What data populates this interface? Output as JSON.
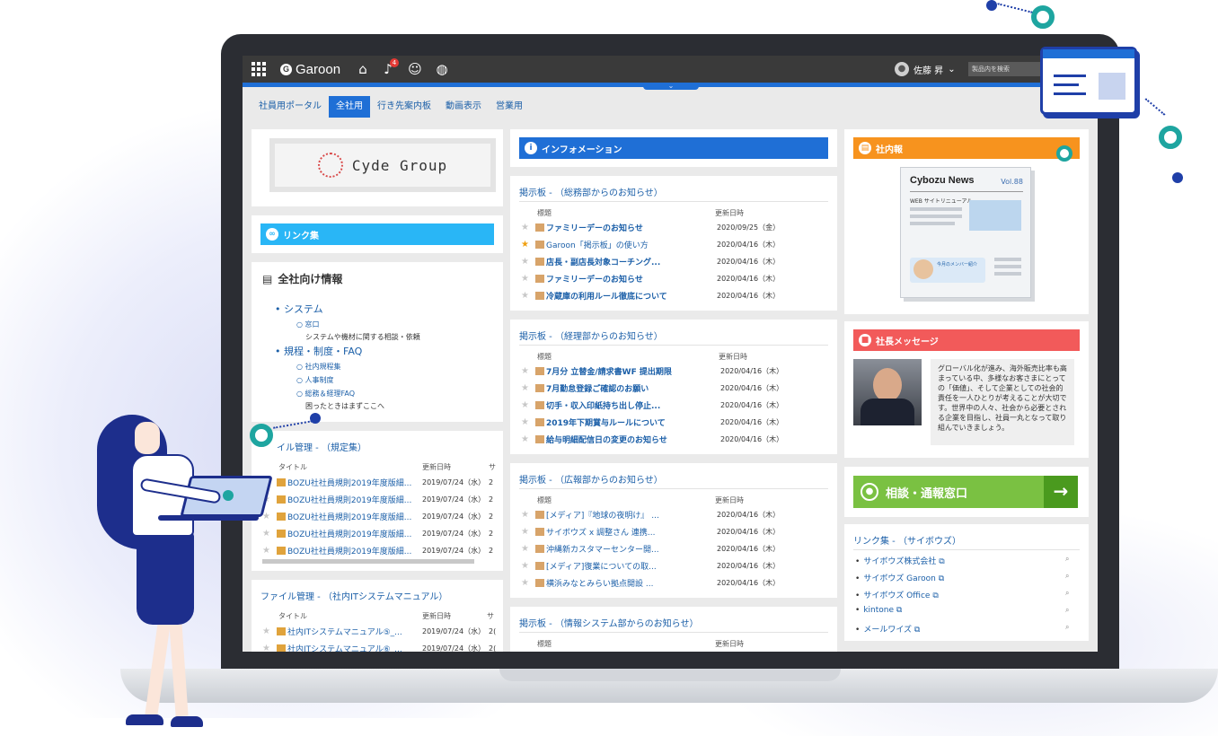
{
  "topbar": {
    "logo": "Garoon",
    "notification_count": "4",
    "user_name": "佐藤 昇",
    "search_placeholder": "製品内を検索"
  },
  "tabs": [
    "社員用ポータル",
    "全社用",
    "行き先案内板",
    "動画表示",
    "営業用"
  ],
  "active_tab": 1,
  "left": {
    "logo_text": "Cyde Group",
    "links_header": "リンク集",
    "info": {
      "title": "全社向け情報",
      "items": [
        {
          "label": "システム",
          "children": [
            {
              "label": "窓口",
              "note": "システムや機材に関する相談・依頼"
            }
          ]
        },
        {
          "label": "規程・制度・FAQ",
          "children": [
            {
              "label": "社内規程集",
              "note": ""
            },
            {
              "label": "人事制度",
              "note": ""
            },
            {
              "label": "総務＆経理FAQ",
              "note": "困ったときはまずここへ"
            }
          ]
        }
      ]
    },
    "files1": {
      "title": "イル管理 - （規定集）",
      "col_title": "タイトル",
      "col_date": "更新日時",
      "col_extra": "サ",
      "rows": [
        {
          "title": "BOZU社社員規則2019年度版細...",
          "date": "2019/07/24（水）",
          "extra": "2"
        },
        {
          "title": "BOZU社社員規則2019年度版細...",
          "date": "2019/07/24（水）",
          "extra": "2"
        },
        {
          "title": "BOZU社社員規則2019年度版細...",
          "date": "2019/07/24（水）",
          "extra": "2"
        },
        {
          "title": "BOZU社社員規則2019年度版細...",
          "date": "2019/07/24（水）",
          "extra": "2"
        },
        {
          "title": "BOZU社社員規則2019年度版細...",
          "date": "2019/07/24（水）",
          "extra": "2"
        }
      ]
    },
    "files2": {
      "title": "ファイル管理 - （社内ITシステムマニュアル）",
      "col_title": "タイトル",
      "col_date": "更新日時",
      "col_extra": "サ",
      "rows": [
        {
          "title": "社内ITシステムマニュアル⑤_...",
          "date": "2019/07/24（水）",
          "extra": "2("
        },
        {
          "title": "社内ITシステムマニュアル⑥_...",
          "date": "2019/07/24（水）",
          "extra": "2("
        }
      ]
    }
  },
  "center": {
    "info_header": "インフォメーション",
    "boards": [
      {
        "title": "掲示板 - （総務部からのお知らせ）",
        "col_title": "標題",
        "col_date": "更新日時",
        "rows": [
          {
            "title": "ファミリーデーのお知らせ",
            "date": "2020/09/25（金）",
            "starred": false,
            "bold": true
          },
          {
            "title": "Garoon「掲示板」の使い方",
            "date": "2020/04/16（木）",
            "starred": true,
            "bold": false
          },
          {
            "title": "店長・副店長対象コーチング...",
            "date": "2020/04/16（木）",
            "starred": false,
            "bold": true
          },
          {
            "title": "ファミリーデーのお知らせ",
            "date": "2020/04/16（木）",
            "starred": false,
            "bold": true
          },
          {
            "title": "冷蔵庫の利用ルール徹底について",
            "date": "2020/04/16（木）",
            "starred": false,
            "bold": true
          }
        ]
      },
      {
        "title": "掲示板 - （経理部からのお知らせ）",
        "col_title": "標題",
        "col_date": "更新日時",
        "rows": [
          {
            "title": "7月分 立替金/請求書WF 提出期限",
            "date": "2020/04/16（木）",
            "starred": false,
            "bold": true
          },
          {
            "title": "7月勤怠登録ご確認のお願い",
            "date": "2020/04/16（木）",
            "starred": false,
            "bold": true
          },
          {
            "title": "切手・収入印紙持ち出し停止...",
            "date": "2020/04/16（木）",
            "starred": false,
            "bold": true
          },
          {
            "title": "2019年下期賞与ルールについて",
            "date": "2020/04/16（木）",
            "starred": false,
            "bold": true
          },
          {
            "title": "給与明細配信日の変更のお知らせ",
            "date": "2020/04/16（木）",
            "starred": false,
            "bold": true
          }
        ]
      },
      {
        "title": "掲示板 - （広報部からのお知らせ）",
        "col_title": "標題",
        "col_date": "更新日時",
        "rows": [
          {
            "title": "[メディア]『地球の夜明け』 ...",
            "date": "2020/04/16（木）",
            "starred": false,
            "bold": false
          },
          {
            "title": "サイボウズ x 調整さん 連携...",
            "date": "2020/04/16（木）",
            "starred": false,
            "bold": false
          },
          {
            "title": "沖縄新カスタマーセンター開...",
            "date": "2020/04/16（木）",
            "starred": false,
            "bold": false
          },
          {
            "title": "[メディア]復業についての取...",
            "date": "2020/04/16（木）",
            "starred": false,
            "bold": false
          },
          {
            "title": "横浜みなとみらい拠点開設 ...",
            "date": "2020/04/16（木）",
            "starred": false,
            "bold": false
          }
        ]
      },
      {
        "title": "掲示板 - （情報システム部からのお知らせ）",
        "col_title": "標題",
        "col_date": "更新日時",
        "rows": []
      }
    ]
  },
  "right": {
    "newsletter_header": "社内報",
    "news_title": "Cybozu News",
    "news_vol": "Vol.88",
    "news_sub": "WEB サイトリニューアル",
    "news_caption": "今月のメンバー紹介",
    "message_header": "社長メッセージ",
    "message_text": "グローバル化が進み、海外販売比率も高まっている中、多様なお客さまにとっての「価値」、そして企業としての社会的責任を一人ひとりが考えることが大切です。世界中の人々、社会から必要とされる企業を目指し、社員一丸となって取り組んでいきましょう。",
    "consult_label": "相談・通報窓口",
    "links_title": "リンク集 - （サイボウズ）",
    "links": [
      "サイボウズ株式会社",
      "サイボウズ Garoon",
      "サイボウズ Office",
      "kintone",
      "メールワイズ"
    ]
  },
  "colors": {
    "accent_blue": "#1f6fd6",
    "links_cyan": "#29b6f6",
    "newsletter_orange": "#f7931e",
    "message_red": "#f25a5a",
    "consult_green": "#7ac142",
    "link_text": "#1b5fa8"
  },
  "icons": {
    "app_menu": "grid-icon",
    "home": "home-icon",
    "notifications": "bell-icon",
    "presence": "smiley-icon",
    "language": "globe-icon",
    "user": "user-icon",
    "info": "info-icon",
    "links": "link-icon",
    "document": "document-icon",
    "star": "star-icon",
    "arrow": "arrow-right-icon",
    "external": "external-link-icon",
    "preview": "magnifier-icon"
  }
}
